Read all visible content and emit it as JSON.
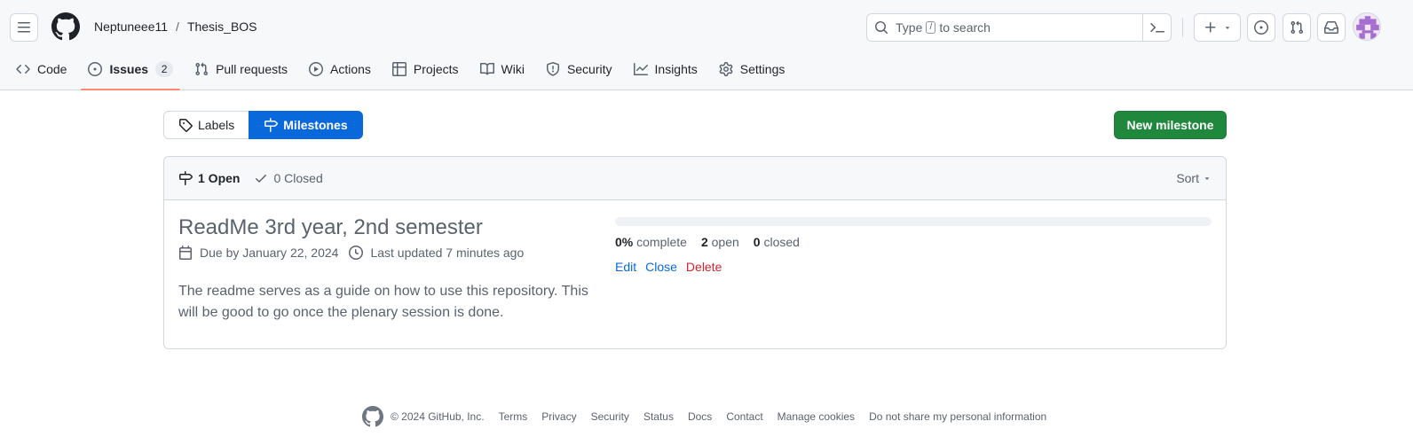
{
  "header": {
    "owner": "Neptuneee11",
    "separator": "/",
    "repo": "Thesis_BOS",
    "search": {
      "before": "Type",
      "key": "/",
      "after": "to search"
    }
  },
  "nav": {
    "tabs": [
      {
        "label": "Code",
        "icon": "code-icon"
      },
      {
        "label": "Issues",
        "icon": "issue-opened-icon",
        "count": "2",
        "active": true
      },
      {
        "label": "Pull requests",
        "icon": "git-pull-request-icon"
      },
      {
        "label": "Actions",
        "icon": "play-icon"
      },
      {
        "label": "Projects",
        "icon": "table-icon"
      },
      {
        "label": "Wiki",
        "icon": "book-icon"
      },
      {
        "label": "Security",
        "icon": "shield-icon"
      },
      {
        "label": "Insights",
        "icon": "graph-icon"
      },
      {
        "label": "Settings",
        "icon": "gear-icon"
      }
    ]
  },
  "subnav": {
    "labels": "Labels",
    "milestones": "Milestones",
    "new_milestone": "New milestone"
  },
  "list": {
    "open": "1 Open",
    "closed": "0 Closed",
    "sort": "Sort"
  },
  "milestone": {
    "title": "ReadMe 3rd year, 2nd semester",
    "due": "Due by January 22, 2024",
    "updated": "Last updated 7 minutes ago",
    "description": "The readme serves as a guide on how to use this repository. This will be good to go once the plenary session is done.",
    "progress_fraction": 0,
    "percent": "0%",
    "percent_label": "complete",
    "open_count": "2",
    "open_label": "open",
    "closed_count": "0",
    "closed_label": "closed",
    "edit": "Edit",
    "close": "Close",
    "delete": "Delete"
  },
  "footer": {
    "copyright": "© 2024 GitHub, Inc.",
    "links": [
      "Terms",
      "Privacy",
      "Security",
      "Status",
      "Docs",
      "Contact",
      "Manage cookies",
      "Do not share my personal information"
    ]
  },
  "colors": {
    "accent": "#0969da",
    "primary_button": "#1f883d",
    "danger": "#d1242f",
    "active_underline": "#fd8c73"
  }
}
